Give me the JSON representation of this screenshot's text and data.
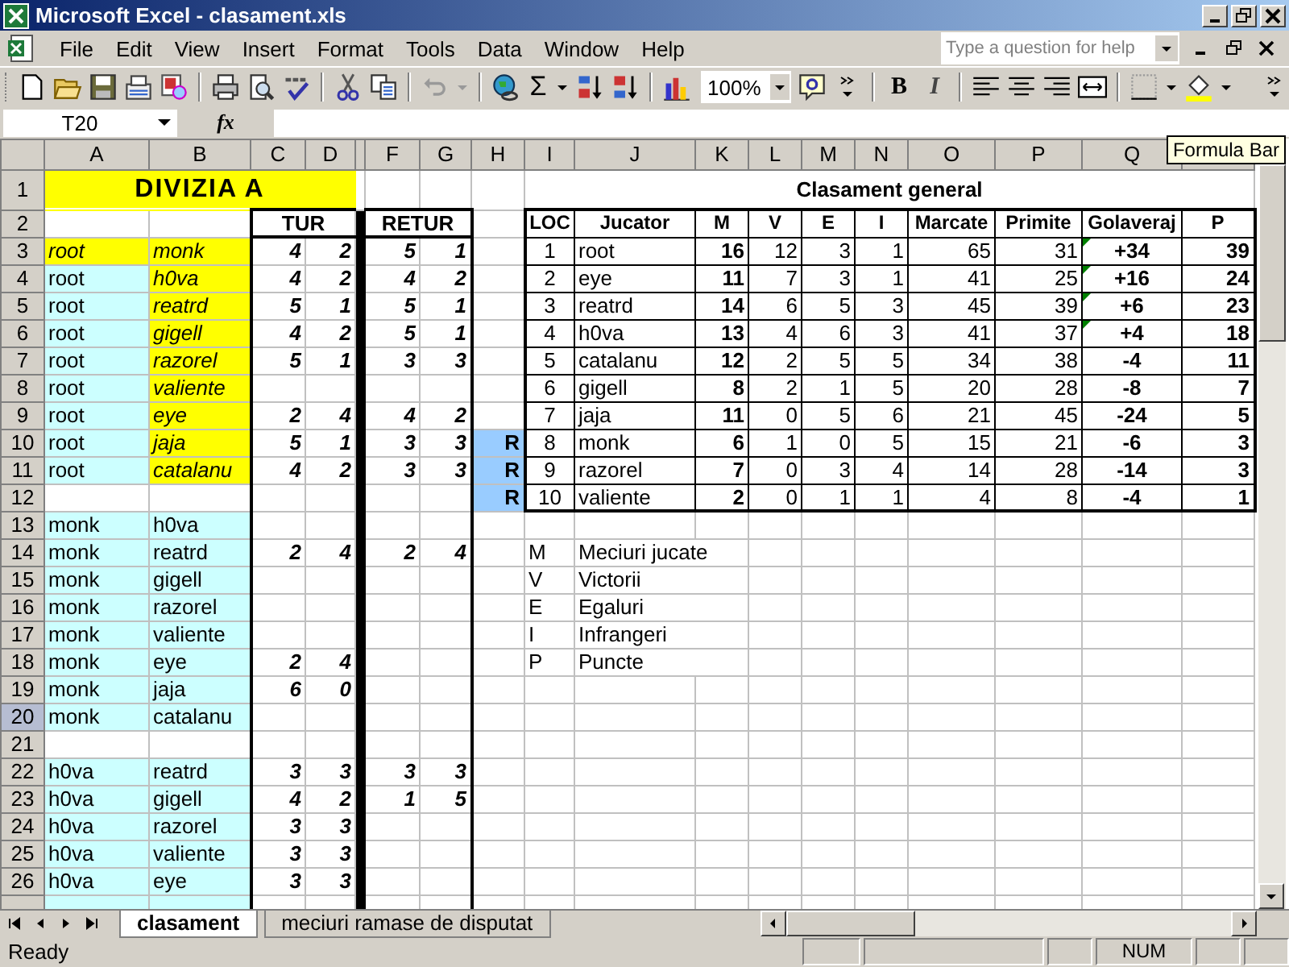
{
  "window": {
    "title": "Microsoft Excel - clasament.xls"
  },
  "menu": [
    "File",
    "Edit",
    "View",
    "Insert",
    "Format",
    "Tools",
    "Data",
    "Window",
    "Help"
  ],
  "help_box": {
    "placeholder": "Type a question for help"
  },
  "toolbar": {
    "sum": "Σ",
    "zoom": "100%",
    "bold": "B",
    "italic": "I"
  },
  "formula_bar": {
    "name_box": "T20",
    "fx": "fx"
  },
  "tooltip": "Formula Bar",
  "columns": [
    "A",
    "B",
    "C",
    "D",
    "F",
    "G",
    "H",
    "I",
    "J",
    "K",
    "L",
    "M",
    "N",
    "O",
    "P",
    "Q"
  ],
  "row_headers": [
    {
      "label": "1",
      "selected": false
    },
    {
      "label": "2",
      "selected": false
    },
    {
      "label": "3",
      "selected": false
    },
    {
      "label": "4",
      "selected": false
    },
    {
      "label": "5",
      "selected": false
    },
    {
      "label": "6",
      "selected": false
    },
    {
      "label": "7",
      "selected": false
    },
    {
      "label": "8",
      "selected": false
    },
    {
      "label": "9",
      "selected": false
    },
    {
      "label": "10",
      "selected": false
    },
    {
      "label": "11",
      "selected": false
    },
    {
      "label": "12",
      "selected": false
    },
    {
      "label": "13",
      "selected": false
    },
    {
      "label": "14",
      "selected": false
    },
    {
      "label": "15",
      "selected": false
    },
    {
      "label": "16",
      "selected": false
    },
    {
      "label": "17",
      "selected": false
    },
    {
      "label": "18",
      "selected": false
    },
    {
      "label": "19",
      "selected": false
    },
    {
      "label": "20",
      "selected": true
    },
    {
      "label": "21",
      "selected": false
    },
    {
      "label": "22",
      "selected": false
    },
    {
      "label": "23",
      "selected": false
    },
    {
      "label": "24",
      "selected": false
    },
    {
      "label": "25",
      "selected": false
    },
    {
      "label": "26",
      "selected": false
    }
  ],
  "division": {
    "title": "DIVIZIA A",
    "first_leg": "TUR",
    "second_leg": "RETUR",
    "groups": [
      [
        {
          "home": "root",
          "away": "monk",
          "home_marked": true,
          "away_marked": true,
          "tur": [
            "4",
            "2"
          ],
          "retur": [
            "5",
            "1"
          ]
        },
        {
          "home": "root",
          "away": "h0va",
          "home_marked": false,
          "away_marked": true,
          "tur": [
            "4",
            "2"
          ],
          "retur": [
            "4",
            "2"
          ]
        },
        {
          "home": "root",
          "away": "reatrd",
          "home_marked": false,
          "away_marked": true,
          "tur": [
            "5",
            "1"
          ],
          "retur": [
            "5",
            "1"
          ]
        },
        {
          "home": "root",
          "away": "gigell",
          "home_marked": false,
          "away_marked": true,
          "tur": [
            "4",
            "2"
          ],
          "retur": [
            "5",
            "1"
          ]
        },
        {
          "home": "root",
          "away": "razorel",
          "home_marked": false,
          "away_marked": true,
          "tur": [
            "5",
            "1"
          ],
          "retur": [
            "3",
            "3"
          ]
        },
        {
          "home": "root",
          "away": "valiente",
          "home_marked": false,
          "away_marked": true
        },
        {
          "home": "root",
          "away": "eye",
          "home_marked": false,
          "away_marked": true,
          "tur": [
            "2",
            "4"
          ],
          "retur": [
            "4",
            "2"
          ]
        },
        {
          "home": "root",
          "away": "jaja",
          "home_marked": false,
          "away_marked": true,
          "tur": [
            "5",
            "1"
          ],
          "retur": [
            "3",
            "3"
          ]
        },
        {
          "home": "root",
          "away": "catalanu",
          "home_marked": false,
          "away_marked": true,
          "tur": [
            "4",
            "2"
          ],
          "retur": [
            "3",
            "3"
          ]
        }
      ],
      [
        {
          "home": "monk",
          "away": "h0va",
          "home_marked": false,
          "away_marked": false
        },
        {
          "home": "monk",
          "away": "reatrd",
          "home_marked": false,
          "away_marked": false,
          "tur": [
            "2",
            "4"
          ],
          "retur": [
            "2",
            "4"
          ]
        },
        {
          "home": "monk",
          "away": "gigell",
          "home_marked": false,
          "away_marked": false
        },
        {
          "home": "monk",
          "away": "razorel",
          "home_marked": false,
          "away_marked": false
        },
        {
          "home": "monk",
          "away": "valiente",
          "home_marked": false,
          "away_marked": false
        },
        {
          "home": "monk",
          "away": "eye",
          "home_marked": false,
          "away_marked": false,
          "tur": [
            "2",
            "4"
          ]
        },
        {
          "home": "monk",
          "away": "jaja",
          "home_marked": false,
          "away_marked": false,
          "tur": [
            "6",
            "0"
          ]
        },
        {
          "home": "monk",
          "away": "catalanu",
          "home_marked": false,
          "away_marked": false
        }
      ],
      [
        {
          "home": "h0va",
          "away": "reatrd",
          "home_marked": false,
          "away_marked": false,
          "tur": [
            "3",
            "3"
          ],
          "retur": [
            "3",
            "3"
          ]
        },
        {
          "home": "h0va",
          "away": "gigell",
          "home_marked": false,
          "away_marked": false,
          "tur": [
            "4",
            "2"
          ],
          "retur": [
            "1",
            "5"
          ]
        },
        {
          "home": "h0va",
          "away": "razorel",
          "home_marked": false,
          "away_marked": false,
          "tur": [
            "3",
            "3"
          ]
        },
        {
          "home": "h0va",
          "away": "valiente",
          "home_marked": false,
          "away_marked": false,
          "tur": [
            "3",
            "3"
          ]
        },
        {
          "home": "h0va",
          "away": "eye",
          "home_marked": false,
          "away_marked": false,
          "tur": [
            "3",
            "3"
          ]
        }
      ]
    ]
  },
  "standings": {
    "title": "Clasament general",
    "columns": [
      "LOC",
      "Jucator",
      "M",
      "V",
      "E",
      "I",
      "Marcate",
      "Primite",
      "Golaveraj",
      "P"
    ],
    "rows": [
      {
        "cells": [
          "1",
          "root",
          "16",
          "12",
          "3",
          "1",
          "65",
          "31",
          "+34",
          "39"
        ],
        "flagged": true
      },
      {
        "cells": [
          "2",
          "eye",
          "11",
          "7",
          "3",
          "1",
          "41",
          "25",
          "+16",
          "24"
        ],
        "flagged": true
      },
      {
        "cells": [
          "3",
          "reatrd",
          "14",
          "6",
          "5",
          "3",
          "45",
          "39",
          "+6",
          "23"
        ],
        "flagged": true
      },
      {
        "cells": [
          "4",
          "h0va",
          "13",
          "4",
          "6",
          "3",
          "41",
          "37",
          "+4",
          "18"
        ],
        "flagged": true
      },
      {
        "cells": [
          "5",
          "catalanu",
          "12",
          "2",
          "5",
          "5",
          "34",
          "38",
          "-4",
          "11"
        ],
        "flagged": false
      },
      {
        "cells": [
          "6",
          "gigell",
          "8",
          "2",
          "1",
          "5",
          "20",
          "28",
          "-8",
          "7"
        ],
        "flagged": false
      },
      {
        "cells": [
          "7",
          "jaja",
          "11",
          "0",
          "5",
          "6",
          "21",
          "45",
          "-24",
          "5"
        ],
        "flagged": false
      },
      {
        "zone": "R",
        "cells": [
          "8",
          "monk",
          "6",
          "1",
          "0",
          "5",
          "15",
          "21",
          "-6",
          "3"
        ],
        "flagged": false
      },
      {
        "zone": "R",
        "cells": [
          "9",
          "razorel",
          "7",
          "0",
          "3",
          "4",
          "14",
          "28",
          "-14",
          "3"
        ],
        "flagged": false
      },
      {
        "zone": "R",
        "cells": [
          "10",
          "valiente",
          "2",
          "0",
          "1",
          "1",
          "4",
          "8",
          "-4",
          "1"
        ],
        "flagged": false
      }
    ]
  },
  "legend": [
    {
      "key": "M",
      "text": "Meciuri jucate"
    },
    {
      "key": "V",
      "text": "Victorii"
    },
    {
      "key": "E",
      "text": "Egaluri"
    },
    {
      "key": "I",
      "text": "Infrangeri"
    },
    {
      "key": "P",
      "text": "Puncte"
    }
  ],
  "sheet_tabs": [
    {
      "label": "clasament",
      "selected": true
    },
    {
      "label": "meciuri ramase de disputat",
      "selected": false
    }
  ],
  "status_bar": {
    "text": "Ready",
    "indicators": [
      "NUM"
    ]
  }
}
